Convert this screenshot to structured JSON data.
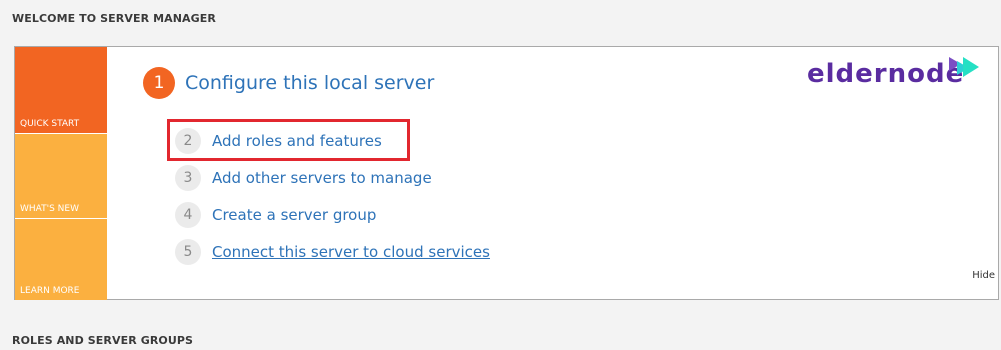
{
  "sections": {
    "welcome": "WELCOME TO SERVER MANAGER",
    "roles": "ROLES AND SERVER GROUPS"
  },
  "sidebar": {
    "tiles": [
      {
        "label": "QUICK START",
        "color": "#f26522"
      },
      {
        "label": "WHAT'S NEW",
        "color": "#fbb040"
      },
      {
        "label": "LEARN MORE",
        "color": "#fbb040"
      }
    ]
  },
  "main_step": {
    "number": "1",
    "label": "Configure this local server"
  },
  "steps": [
    {
      "number": "2",
      "label": "Add roles and features",
      "highlighted": true
    },
    {
      "number": "3",
      "label": "Add other servers to manage"
    },
    {
      "number": "4",
      "label": "Create a server group"
    },
    {
      "number": "5",
      "label": "Connect this server to cloud services",
      "underlined": true
    }
  ],
  "hide_label": "Hide",
  "logo": {
    "text": "eldernode",
    "icon": "play-arrows-icon"
  },
  "colors": {
    "accent_orange": "#f26522",
    "tile_yellow": "#fbb040",
    "link_blue": "#2e73b8",
    "highlight_red": "#e2272f"
  }
}
